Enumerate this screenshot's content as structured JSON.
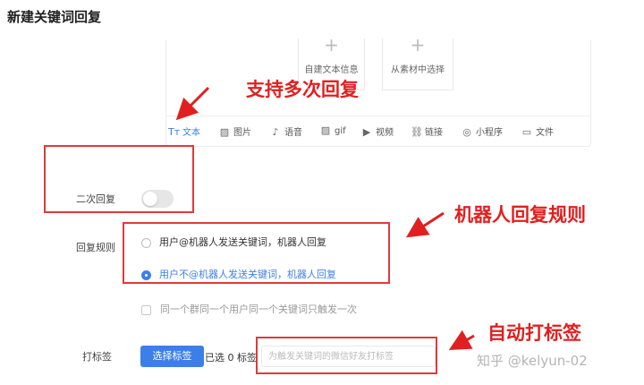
{
  "page": {
    "title": "新建关键词回复"
  },
  "editor": {
    "add_cards": [
      {
        "plus": "+",
        "label": "自建文本信息"
      },
      {
        "plus": "+",
        "label": "从素材中选择"
      }
    ],
    "toolbar": [
      {
        "icon": "Tт",
        "label": "文本"
      },
      {
        "icon": "▨",
        "label": "图片"
      },
      {
        "icon": "♪",
        "label": "语音"
      },
      {
        "icon": "▨",
        "label": "gif"
      },
      {
        "icon": "▶",
        "label": "视频"
      },
      {
        "icon": "⛓",
        "label": "链接"
      },
      {
        "icon": "◎",
        "label": "小程序"
      },
      {
        "icon": "▭",
        "label": "文件"
      }
    ]
  },
  "form": {
    "multi_reply_label": "二次回复",
    "multi_reply_enabled": false,
    "rule_label": "回复规则",
    "rule_options": [
      {
        "label": "用户@机器人发送关键词，机器人回复",
        "selected": false
      },
      {
        "label": "用户不@机器人发送关键词，机器人回复",
        "selected": true
      }
    ],
    "once_checkbox_label": "同一个群同一个用户同一个关键词只触发一次",
    "tag_label": "打标签",
    "tag_button": "选择标签",
    "tag_count": "已选 0 标签",
    "tag_placeholder": "为触发关键词的微信好友打标签"
  },
  "annotations": {
    "multi_reply": "支持多次回复",
    "robot_rule": "机器人回复规则",
    "auto_tag": "自动打标签",
    "color": "#e02020"
  },
  "watermark": "知乎 @kelyun-02",
  "colors": {
    "accent": "#3d7fe8",
    "annotation": "#e02020"
  }
}
